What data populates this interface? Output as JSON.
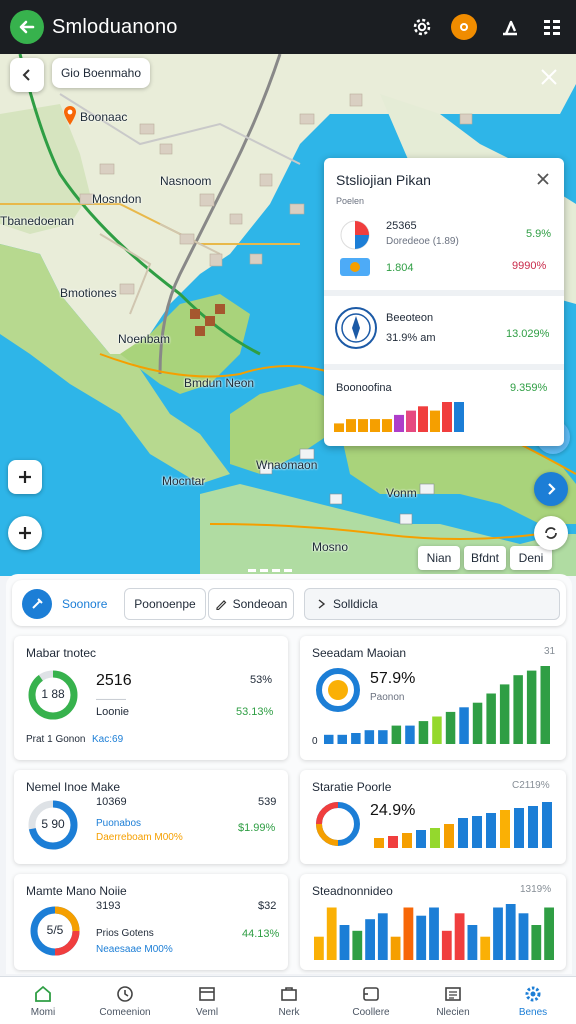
{
  "header": {
    "title": "Smloduanono",
    "icons": [
      "back-arrow-icon",
      "gear-icon",
      "flame-icon",
      "share-icon",
      "grid-menu-icon"
    ]
  },
  "map": {
    "search_pill": "Gio Boenmaho",
    "labels": [
      {
        "text": "Boonaac"
      },
      {
        "text": "Nasnoom"
      },
      {
        "text": "Mosndon"
      },
      {
        "text": "Tbanedoenan"
      },
      {
        "text": "Bmotiones"
      },
      {
        "text": "Noenbam"
      },
      {
        "text": "Bmdun Neon"
      },
      {
        "text": "Wnaomaon"
      },
      {
        "text": "Mocntar"
      },
      {
        "text": "Vonm"
      },
      {
        "text": "Mosno"
      }
    ],
    "filter_chips": [
      "Nian",
      "Bfdnt",
      "Deni"
    ]
  },
  "overlay": {
    "title": "Stsliojian Pikan",
    "subtitle": "Poelen",
    "row1": {
      "value": "25365",
      "sub": "Doredeoe (1.89)",
      "pct_top": "5.9%",
      "pct_bottom": "9990%",
      "value2": "1.804"
    },
    "row2": {
      "name": "Beeoteon",
      "value": "31.9% am",
      "pct": "13.029%"
    },
    "row3": {
      "name": "Boonoofina",
      "pct": "9.359%"
    },
    "bars": [
      {
        "value": 2,
        "color": "#f59f00"
      },
      {
        "value": 3,
        "color": "#f59f00"
      },
      {
        "value": 3,
        "color": "#f59f00"
      },
      {
        "value": 3,
        "color": "#f59f00"
      },
      {
        "value": 3,
        "color": "#f59f00"
      },
      {
        "value": 4,
        "color": "#ae3ec9"
      },
      {
        "value": 5,
        "color": "#e64980"
      },
      {
        "value": 6,
        "color": "#f03e3e"
      },
      {
        "value": 5,
        "color": "#f59f00"
      },
      {
        "value": 7,
        "color": "#f03e3e"
      },
      {
        "value": 7,
        "color": "#1c7ed6"
      }
    ]
  },
  "tabs": {
    "active": "Soonore",
    "items": [
      "Poonoenpe",
      "Sondeoan",
      "Solldicla"
    ]
  },
  "cards": {
    "c1": {
      "title": "Mabar tnotec",
      "donut_label": "1 88",
      "value": "2516",
      "sub": "Loonie",
      "pct_top": "53%",
      "pct_bottom": "53.13%",
      "footer_a": "Prat 1 Gonon",
      "footer_b": "Kac:69",
      "donut_pct": 0.9
    },
    "c2": {
      "title": "Seeadam Maoian",
      "corner": "31",
      "value": "57.9%",
      "sub": "Paonon",
      "axis_zero": "0",
      "bars": [
        {
          "value": 1,
          "color": "#1c7ed6"
        },
        {
          "value": 1,
          "color": "#1c7ed6"
        },
        {
          "value": 1.2,
          "color": "#1c7ed6"
        },
        {
          "value": 1.5,
          "color": "#1c7ed6"
        },
        {
          "value": 1.5,
          "color": "#1c7ed6"
        },
        {
          "value": 2,
          "color": "#2f9e44"
        },
        {
          "value": 2,
          "color": "#1c7ed6"
        },
        {
          "value": 2.5,
          "color": "#2f9e44"
        },
        {
          "value": 3,
          "color": "#94d82d"
        },
        {
          "value": 3.5,
          "color": "#2f9e44"
        },
        {
          "value": 4,
          "color": "#1c7ed6"
        },
        {
          "value": 4.5,
          "color": "#2f9e44"
        },
        {
          "value": 5.5,
          "color": "#2f9e44"
        },
        {
          "value": 6.5,
          "color": "#2f9e44"
        },
        {
          "value": 7.5,
          "color": "#2f9e44"
        },
        {
          "value": 8,
          "color": "#2f9e44"
        },
        {
          "value": 8.5,
          "color": "#2f9e44"
        }
      ]
    },
    "c3": {
      "title": "Nemel Inoe Make",
      "value": "10369",
      "sub": "Puonabos",
      "sub2": "Daerreboam M00%",
      "pct_top": "539",
      "pct_bottom": "$1.99%",
      "donut_label": "5 90",
      "donut_pct": 0.72
    },
    "c4": {
      "title": "Staratie Poorle",
      "corner": "C2119%",
      "value": "24.9%",
      "bars": [
        {
          "value": 1,
          "color": "#f59f00"
        },
        {
          "value": 1.2,
          "color": "#f03e3e"
        },
        {
          "value": 1.5,
          "color": "#f59f00"
        },
        {
          "value": 1.8,
          "color": "#1c7ed6"
        },
        {
          "value": 2,
          "color": "#94d82d"
        },
        {
          "value": 2.4,
          "color": "#f59f00"
        },
        {
          "value": 3,
          "color": "#1c7ed6"
        },
        {
          "value": 3.2,
          "color": "#1c7ed6"
        },
        {
          "value": 3.5,
          "color": "#1c7ed6"
        },
        {
          "value": 3.8,
          "color": "#fab005"
        },
        {
          "value": 4,
          "color": "#1c7ed6"
        },
        {
          "value": 4.2,
          "color": "#1c7ed6"
        },
        {
          "value": 4.6,
          "color": "#1c7ed6"
        }
      ]
    },
    "c5": {
      "title": "Mamte Mano Noiie",
      "value": "3193",
      "sub": "Prios Gotens",
      "sub2": "Neaesaae M00%",
      "pct_top": "$32",
      "pct_bottom": "44.13%",
      "donut_label": "5/5"
    },
    "c6": {
      "title": "Steadnonnideo",
      "corner": "1319%",
      "bars": [
        {
          "value": 2,
          "color": "#fab005"
        },
        {
          "value": 4.5,
          "color": "#fab005"
        },
        {
          "value": 3,
          "color": "#1c7ed6"
        },
        {
          "value": 2.5,
          "color": "#2f9e44"
        },
        {
          "value": 3.5,
          "color": "#1c7ed6"
        },
        {
          "value": 4,
          "color": "#1c7ed6"
        },
        {
          "value": 2,
          "color": "#f59f00"
        },
        {
          "value": 4.5,
          "color": "#f76707"
        },
        {
          "value": 3.8,
          "color": "#1c7ed6"
        },
        {
          "value": 4.5,
          "color": "#1c7ed6"
        },
        {
          "value": 2.5,
          "color": "#f03e3e"
        },
        {
          "value": 4,
          "color": "#f03e3e"
        },
        {
          "value": 3,
          "color": "#1c7ed6"
        },
        {
          "value": 2,
          "color": "#fab005"
        },
        {
          "value": 4.5,
          "color": "#1c7ed6"
        },
        {
          "value": 4.8,
          "color": "#1c7ed6"
        },
        {
          "value": 4,
          "color": "#1c7ed6"
        },
        {
          "value": 3,
          "color": "#2f9e44"
        },
        {
          "value": 4.5,
          "color": "#2f9e44"
        }
      ]
    }
  },
  "bottom_nav": [
    {
      "label": "Momi",
      "icon": "home-icon",
      "active": false
    },
    {
      "label": "Comeenion",
      "icon": "clock-icon",
      "active": false
    },
    {
      "label": "Veml",
      "icon": "window-icon",
      "active": false
    },
    {
      "label": "Nerk",
      "icon": "briefcase-icon",
      "active": false
    },
    {
      "label": "Coollere",
      "icon": "gallery-icon",
      "active": false
    },
    {
      "label": "Nlecien",
      "icon": "news-icon",
      "active": false
    },
    {
      "label": "Benes",
      "icon": "settings-icon",
      "active": true
    }
  ]
}
